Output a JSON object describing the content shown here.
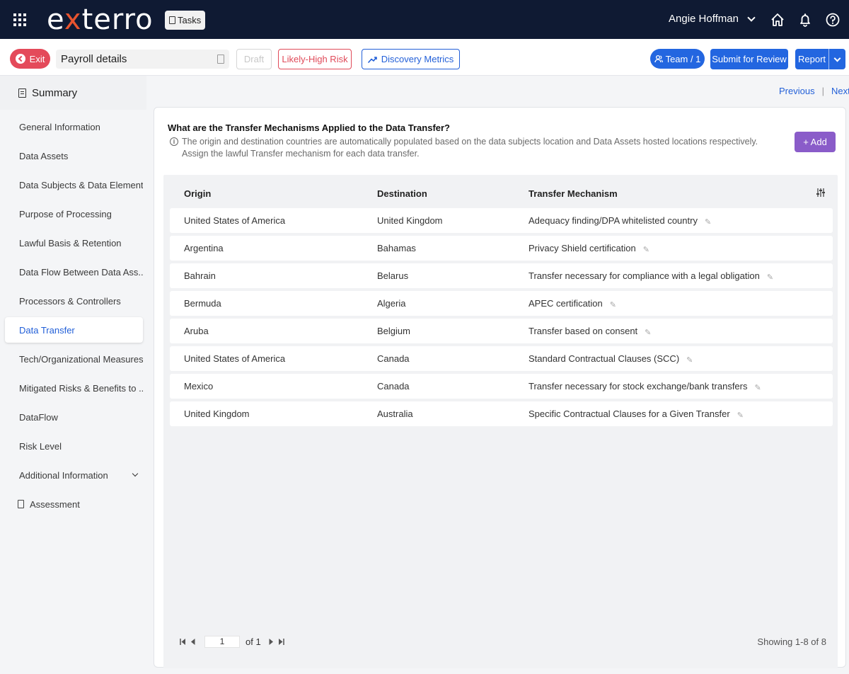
{
  "topbar": {
    "logo": {
      "pre": "e",
      "x": "x",
      "post": "terro"
    },
    "tasks_label": "Tasks",
    "user_name": "Angie Hoffman"
  },
  "actionbar": {
    "exit_label": "Exit",
    "title_value": "Payroll details",
    "draft_label": "Draft",
    "risk_label": "Likely-High Risk",
    "metrics_label": "Discovery Metrics",
    "team_label": "Team / 1",
    "submit_label": "Submit for Review",
    "report_label": "Report"
  },
  "sidebar": {
    "summary_label": "Summary",
    "items": [
      {
        "label": "General Information"
      },
      {
        "label": "Data Assets"
      },
      {
        "label": "Data Subjects & Data Elements"
      },
      {
        "label": "Purpose of Processing"
      },
      {
        "label": "Lawful Basis & Retention"
      },
      {
        "label": "Data Flow Between Data Ass..."
      },
      {
        "label": "Processors & Controllers"
      },
      {
        "label": "Data Transfer"
      },
      {
        "label": "Tech/Organizational Measures"
      },
      {
        "label": "Mitigated Risks & Benefits to ..."
      },
      {
        "label": "DataFlow"
      },
      {
        "label": "Risk Level"
      },
      {
        "label": "Additional Information"
      },
      {
        "label": "Assessment"
      }
    ],
    "active_item": "Data Transfer"
  },
  "pager": {
    "previous": "Previous",
    "separator": "|",
    "next": "Next"
  },
  "main": {
    "question": "What are the Transfer Mechanisms Applied to the Data Transfer?",
    "description_line1": "The origin and destination countries are automatically populated based on the data subjects location and Data Assets hosted locations respectively.",
    "description_line2": "Assign the lawful Transfer mechanism for each data transfer.",
    "add_label": "+ Add",
    "table": {
      "headers": [
        "Origin",
        "Destination",
        "Transfer Mechanism"
      ],
      "rows": [
        [
          "United States of America",
          "United Kingdom",
          "Adequacy finding/DPA whitelisted country"
        ],
        [
          "Argentina",
          "Bahamas",
          "Privacy Shield certification"
        ],
        [
          "Bahrain",
          "Belarus",
          "Transfer necessary for compliance with a legal obligation"
        ],
        [
          "Bermuda",
          "Algeria",
          "APEC certification"
        ],
        [
          "Aruba",
          "Belgium",
          "Transfer based on consent"
        ],
        [
          "United States of America",
          "Canada",
          "Standard Contractual Clauses (SCC)"
        ],
        [
          "Mexico",
          "Canada",
          "Transfer necessary for stock exchange/bank transfers"
        ],
        [
          "United Kingdom",
          "Australia",
          "Specific Contractual Clauses for a Given Transfer"
        ]
      ]
    },
    "footer": {
      "page_value": "1",
      "page_of": "of 1",
      "showing": "Showing 1-8 of 8"
    }
  },
  "colors": {
    "topbar_bg": "#0f1a33",
    "brand_orange": "#e8542f",
    "primary_blue": "#2366e0",
    "risk_red": "#e04a59",
    "add_purple": "#8a5cc9"
  },
  "icons": [
    "apps-grid-icon",
    "clipboard-icon",
    "chevron-down-icon",
    "home-icon",
    "bell-icon",
    "help-icon",
    "back-arrow-icon",
    "document-icon",
    "trend-line-icon",
    "user-group-icon",
    "info-icon",
    "column-settings-icon",
    "pencil-icon",
    "first-page-icon",
    "prev-page-icon",
    "next-page-icon",
    "last-page-icon"
  ]
}
